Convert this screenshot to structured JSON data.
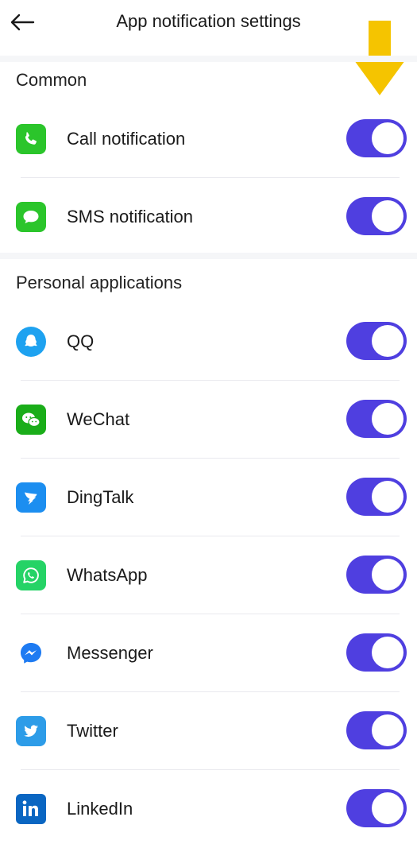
{
  "header": {
    "title": "App notification settings",
    "back_icon": "arrow-left-icon"
  },
  "annotation": {
    "icon": "down-arrow-icon",
    "color": "#F5C400"
  },
  "toggle_color": "#4F3FE0",
  "sections": [
    {
      "title": "Common",
      "items": [
        {
          "label": "Call notification",
          "icon": "phone-icon",
          "icon_color": "#2BC52B",
          "enabled": true
        },
        {
          "label": "SMS notification",
          "icon": "message-bubble-icon",
          "icon_color": "#2BC52B",
          "enabled": true
        }
      ]
    },
    {
      "title": "Personal applications",
      "items": [
        {
          "label": "QQ",
          "icon": "qq-icon",
          "icon_color": "#1EA2F0",
          "enabled": true
        },
        {
          "label": "WeChat",
          "icon": "wechat-icon",
          "icon_color": "#1AAD19",
          "enabled": true
        },
        {
          "label": "DingTalk",
          "icon": "dingtalk-icon",
          "icon_color": "#1C8EF0",
          "enabled": true
        },
        {
          "label": "WhatsApp",
          "icon": "whatsapp-icon",
          "icon_color": "#25D366",
          "enabled": true
        },
        {
          "label": "Messenger",
          "icon": "messenger-icon",
          "icon_color": "#1E7BF2",
          "enabled": true
        },
        {
          "label": "Twitter",
          "icon": "twitter-icon",
          "icon_color": "#2D9CE8",
          "enabled": true
        },
        {
          "label": "LinkedIn",
          "icon": "linkedin-icon",
          "icon_color": "#0A66C2",
          "enabled": true
        }
      ]
    }
  ]
}
